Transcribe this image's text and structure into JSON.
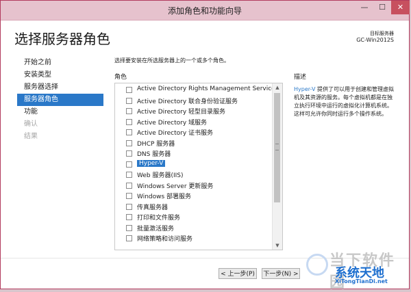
{
  "window": {
    "title": "添加角色和功能向导"
  },
  "window_controls": {
    "minimize": "—",
    "maximize": "☐",
    "close": "✕"
  },
  "header": {
    "page_title": "选择服务器角色",
    "target_label": "目标服务器",
    "target_server": "GC-Win2012S"
  },
  "nav": {
    "items": [
      {
        "label": "开始之前",
        "state": "normal"
      },
      {
        "label": "安装类型",
        "state": "normal"
      },
      {
        "label": "服务器选择",
        "state": "normal"
      },
      {
        "label": "服务器角色",
        "state": "selected"
      },
      {
        "label": "功能",
        "state": "normal"
      },
      {
        "label": "确认",
        "state": "disabled"
      },
      {
        "label": "结果",
        "state": "disabled"
      }
    ]
  },
  "main": {
    "instruction": "选择要安装在所选服务器上的一个或多个角色。",
    "roles_label": "角色",
    "description_label": "描述",
    "roles": [
      {
        "label": "Active Directory Rights Management Services",
        "checked": false
      },
      {
        "label": "Active Directory 联合身份验证服务",
        "checked": false
      },
      {
        "label": "Active Directory 轻型目录服务",
        "checked": false
      },
      {
        "label": "Active Directory 域服务",
        "checked": false
      },
      {
        "label": "Active Directory 证书服务",
        "checked": false
      },
      {
        "label": "DHCP 服务器",
        "checked": false
      },
      {
        "label": "DNS 服务器",
        "checked": false
      },
      {
        "label": "Hyper-V",
        "checked": false,
        "selected": true
      },
      {
        "label": "Web 服务器(IIS)",
        "checked": false
      },
      {
        "label": "Windows Server 更新服务",
        "checked": false
      },
      {
        "label": "Windows 部署服务",
        "checked": false
      },
      {
        "label": "传真服务器",
        "checked": false
      },
      {
        "label": "打印和文件服务",
        "checked": false
      },
      {
        "label": "批量激活服务",
        "checked": false
      },
      {
        "label": "网络策略和访问服务",
        "checked": false
      }
    ],
    "description": {
      "link": "Hyper-V",
      "text": " 提供了可以用于创建和管理虚拟机及其资源的服务。每个虚拟机都是在独立执行环境中运行的虚拟化计算机系统。这样可允许你同时运行多个操作系统。"
    }
  },
  "footer": {
    "prev_label": "< 上一步(P)",
    "next_label": "下一步(N) >"
  },
  "watermark": {
    "line1": "当下软件园",
    "line2": "系统天地",
    "line3": "XiTongTianDi.net"
  },
  "scrollbar": {
    "up_arrow": "▲",
    "down_arrow": "▼"
  },
  "colors": {
    "accent": "#2a78c8",
    "title_bar": "#e6c2cd",
    "close_button": "#c7505f"
  }
}
